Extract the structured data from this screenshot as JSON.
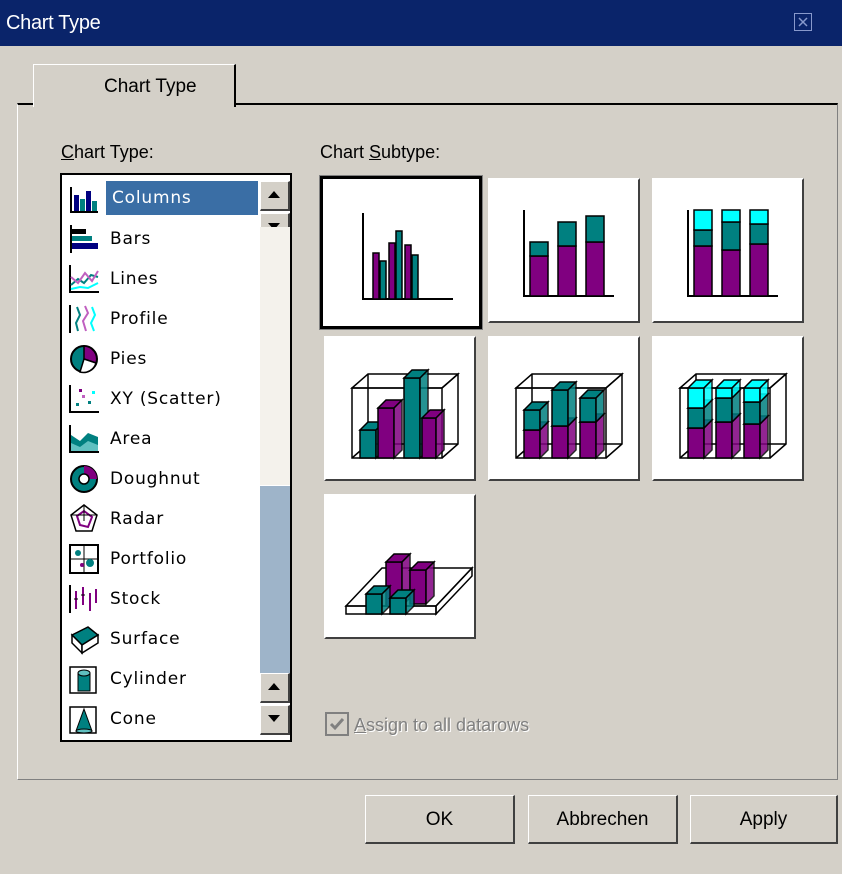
{
  "window": {
    "title": "Chart Type"
  },
  "tab": {
    "label": "Chart Type"
  },
  "chart_type_label": {
    "mnemonic": "C",
    "rest": "hart Type:"
  },
  "chart_subtype_label": {
    "prefix": "Chart ",
    "mnemonic": "S",
    "rest": "ubtype:"
  },
  "chart_types": [
    {
      "label": "Columns",
      "icon": "columns-icon",
      "selected": true
    },
    {
      "label": "Bars",
      "icon": "bars-icon"
    },
    {
      "label": "Lines",
      "icon": "lines-icon"
    },
    {
      "label": "Profile",
      "icon": "profile-icon"
    },
    {
      "label": "Pies",
      "icon": "pies-icon"
    },
    {
      "label": "XY (Scatter)",
      "icon": "scatter-icon"
    },
    {
      "label": "Area",
      "icon": "area-icon"
    },
    {
      "label": "Doughnut",
      "icon": "doughnut-icon"
    },
    {
      "label": "Radar",
      "icon": "radar-icon"
    },
    {
      "label": "Portfolio",
      "icon": "portfolio-icon"
    },
    {
      "label": "Stock",
      "icon": "stock-icon"
    },
    {
      "label": "Surface",
      "icon": "surface-icon"
    },
    {
      "label": "Cylinder",
      "icon": "cylinder-icon"
    },
    {
      "label": "Cone",
      "icon": "cone-icon"
    }
  ],
  "subtypes": [
    {
      "name": "column-clustered",
      "selected": true
    },
    {
      "name": "column-stacked"
    },
    {
      "name": "column-stacked-100"
    },
    {
      "name": "column-3d-clustered"
    },
    {
      "name": "column-3d-stacked"
    },
    {
      "name": "column-3d-stacked-100"
    },
    {
      "name": "column-3d"
    }
  ],
  "assign_checkbox": {
    "mnemonic": "A",
    "rest": "ssign to all datarows",
    "checked": true,
    "enabled": false
  },
  "buttons": {
    "ok": "OK",
    "cancel": "Abbrechen",
    "apply": "Apply"
  },
  "colors": {
    "titlebar": "#0a246a",
    "selection": "#3a6ea5",
    "purple": "#800080",
    "teal": "#008080",
    "cyan": "#00ffff"
  }
}
